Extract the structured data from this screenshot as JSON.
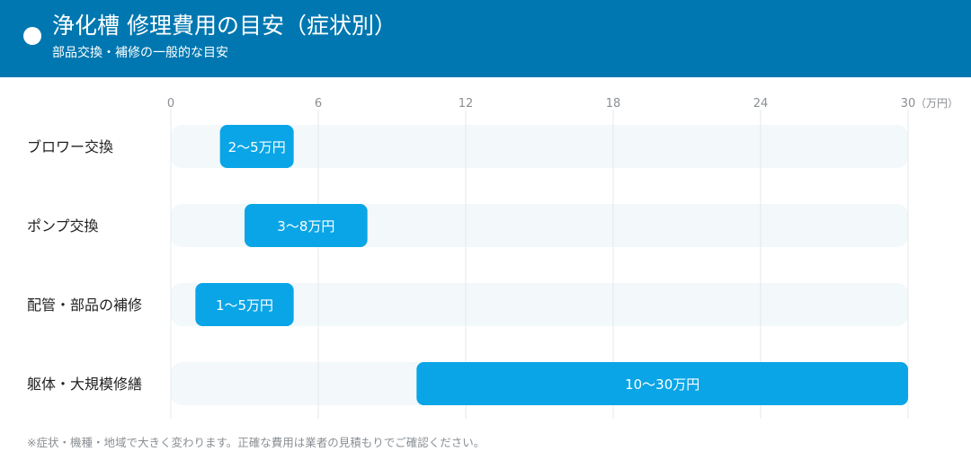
{
  "header": {
    "title": "浄化槽 修理費用の目安（症状別）",
    "subtitle": "部品交換・補修の一般的な目安"
  },
  "chart_data": {
    "type": "bar",
    "orientation": "horizontal",
    "subtype": "range",
    "unit_label": "（万円）",
    "xlim": [
      0,
      30
    ],
    "ticks": [
      0,
      6,
      12,
      18,
      24,
      30
    ],
    "grid": true,
    "categories": [
      "ブロワー交換",
      "ポンプ交換",
      "配管・部品の補修",
      "躯体・大規模修繕"
    ],
    "ranges": [
      {
        "low": 2,
        "high": 5,
        "label": "2〜5万円"
      },
      {
        "low": 3,
        "high": 8,
        "label": "3〜8万円"
      },
      {
        "low": 1,
        "high": 5,
        "label": "1〜5万円"
      },
      {
        "low": 10,
        "high": 30,
        "label": "10〜30万円"
      }
    ]
  },
  "footnote": "※症状・機種・地域で大きく変わります。正確な費用は業者の見積もりでご確認ください。",
  "colors": {
    "header_bg": "#0077b0",
    "bar": "#0aa5e6",
    "track": "#f3f8fb",
    "grid": "#e6e9ec",
    "tick_text": "#8a8f94",
    "label_text": "#222222"
  }
}
